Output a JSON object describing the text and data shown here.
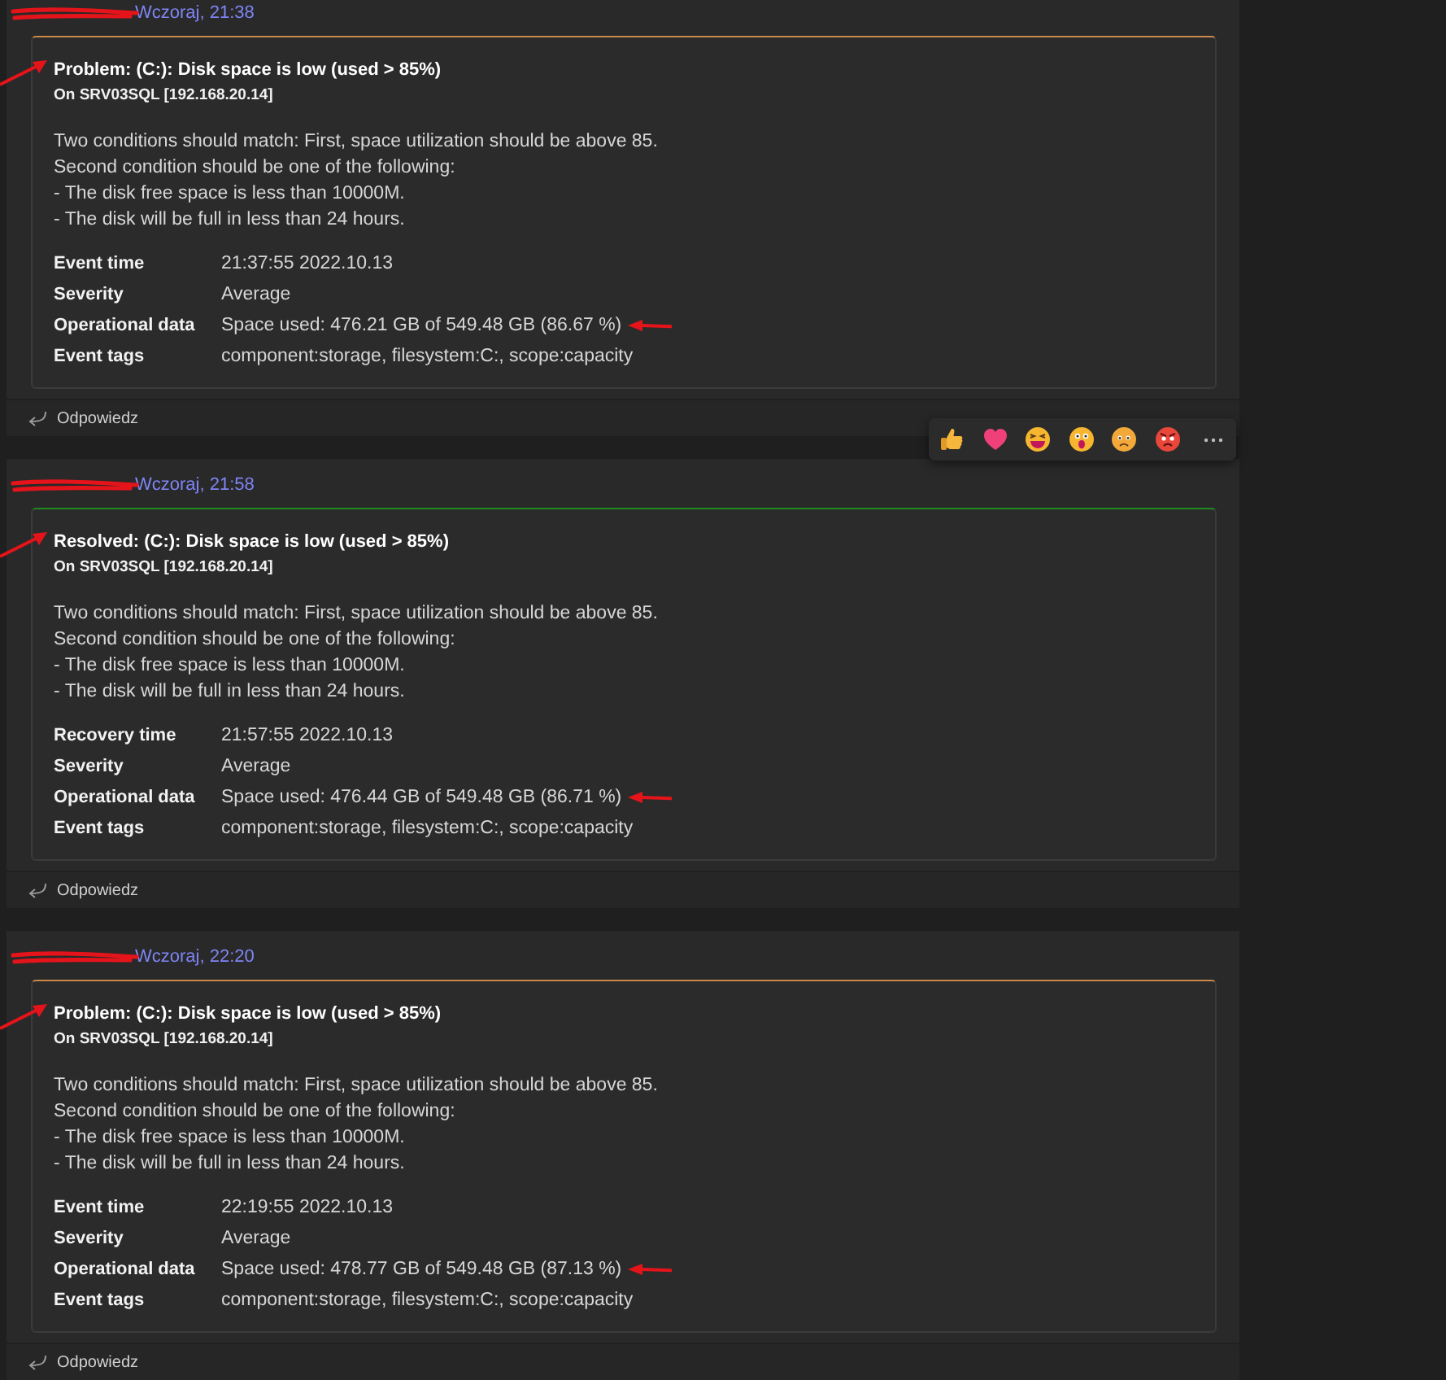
{
  "messages": [
    {
      "time": "Wczoraj, 21:38",
      "color": "#c8894a",
      "title": "Problem: (C:): Disk space is low (used > 85%)",
      "host": "On SRV03SQL [192.168.20.14]",
      "description": "Two conditions should match: First, space utilization should be above 85.\nSecond condition should be one of the following:\n- The disk free space is less than 10000M.\n- The disk will be full in less than 24 hours.",
      "fields": [
        {
          "label": "Event time",
          "value": "21:37:55 2022.10.13",
          "arrow": false
        },
        {
          "label": "Severity",
          "value": "Average",
          "arrow": false
        },
        {
          "label": "Operational data",
          "value": "Space used: 476.21 GB of 549.48 GB (86.67 %)",
          "arrow": true
        },
        {
          "label": "Event tags",
          "value": "component:storage, filesystem:C:, scope:capacity",
          "arrow": false
        }
      ],
      "reply": "Odpowiedz"
    },
    {
      "time": "Wczoraj, 21:58",
      "color": "#1f8a1f",
      "title": "Resolved: (C:): Disk space is low (used > 85%)",
      "host": "On SRV03SQL [192.168.20.14]",
      "description": "Two conditions should match: First, space utilization should be above 85.\nSecond condition should be one of the following:\n- The disk free space is less than 10000M.\n- The disk will be full in less than 24 hours.",
      "fields": [
        {
          "label": "Recovery time",
          "value": "21:57:55 2022.10.13",
          "arrow": false
        },
        {
          "label": "Severity",
          "value": "Average",
          "arrow": false
        },
        {
          "label": "Operational data",
          "value": "Space used: 476.44 GB of 549.48 GB (86.71 %)",
          "arrow": true
        },
        {
          "label": "Event tags",
          "value": "component:storage, filesystem:C:, scope:capacity",
          "arrow": false
        }
      ],
      "reply": "Odpowiedz"
    },
    {
      "time": "Wczoraj, 22:20",
      "color": "#c8894a",
      "title": "Problem: (C:): Disk space is low (used > 85%)",
      "host": "On SRV03SQL [192.168.20.14]",
      "description": "Two conditions should match: First, space utilization should be above 85.\nSecond condition should be one of the following:\n- The disk free space is less than 10000M.\n- The disk will be full in less than 24 hours.",
      "fields": [
        {
          "label": "Event time",
          "value": "22:19:55 2022.10.13",
          "arrow": false
        },
        {
          "label": "Severity",
          "value": "Average",
          "arrow": false
        },
        {
          "label": "Operational data",
          "value": "Space used: 478.77 GB of 549.48 GB (87.13 %)",
          "arrow": true
        },
        {
          "label": "Event tags",
          "value": "component:storage, filesystem:C:, scope:capacity",
          "arrow": false
        }
      ],
      "reply": "Odpowiedz"
    }
  ]
}
